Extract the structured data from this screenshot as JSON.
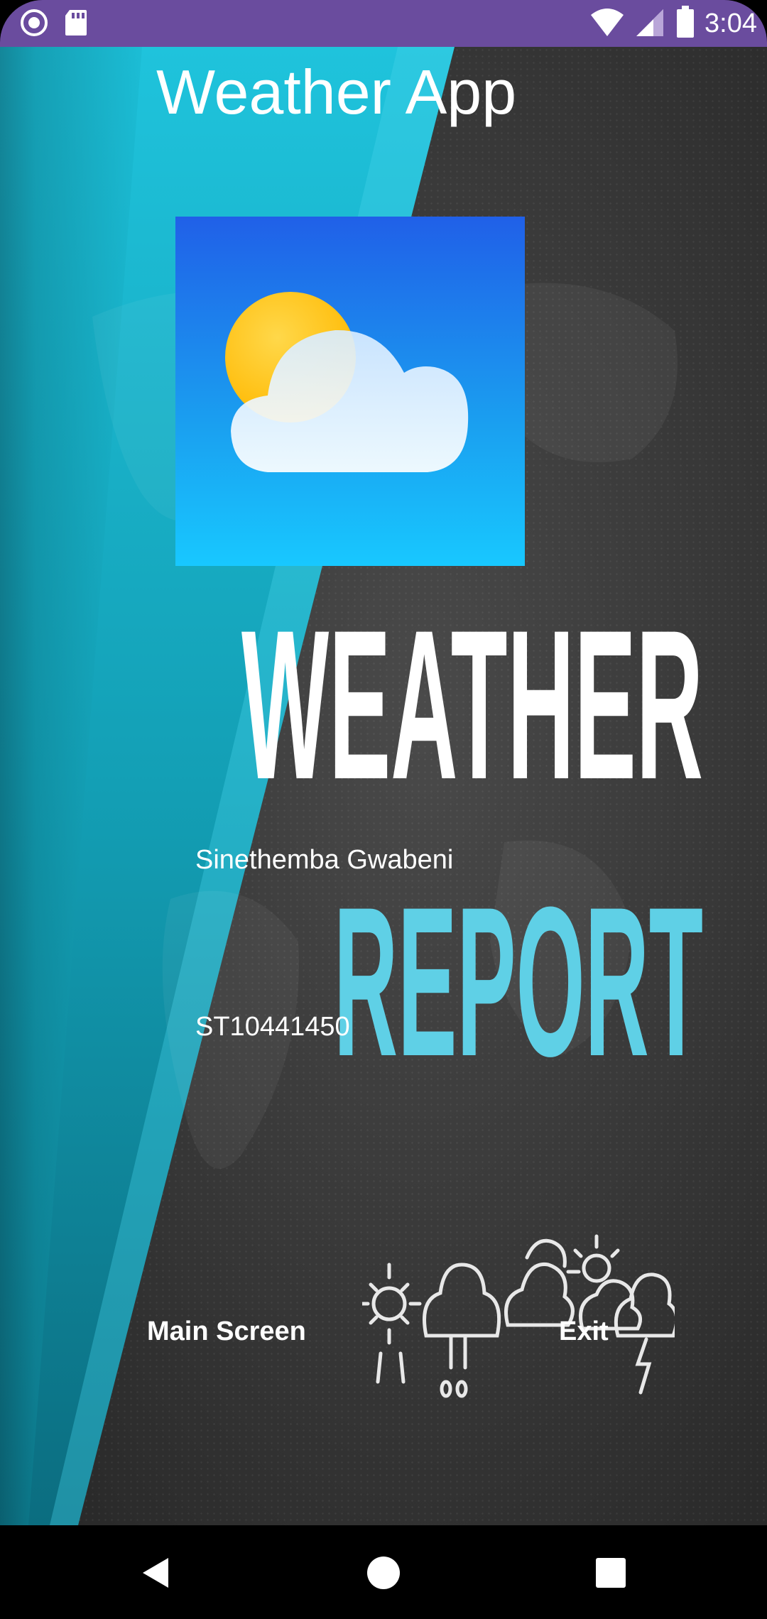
{
  "status_bar": {
    "time": "3:04",
    "icons": [
      "notification-circle-icon",
      "sd-card-icon",
      "wifi-icon",
      "signal-icon",
      "battery-icon"
    ]
  },
  "app": {
    "title": "Weather App",
    "logo_icon": "sun-cloud-icon",
    "background_wordmark": {
      "line1": "WEATHER",
      "line2": "REPORT"
    },
    "student_name": "Sinethemba Gwabeni",
    "student_id": "ST10441450",
    "buttons": {
      "main_screen": "Main Screen",
      "exit": "Exit"
    },
    "decor_icons": [
      "sun-icon",
      "rain-cloud-icon",
      "double-cloud-icon",
      "sun-behind-cloud-icon",
      "storm-cloud-icon"
    ]
  },
  "colors": {
    "status_bar": "#6a4c9e",
    "teal": "#19b8d0",
    "report_text": "#5fd0e6",
    "dark_bg": "#3a3a3a"
  },
  "nav_bar": {
    "icons": [
      "back-icon",
      "home-icon",
      "recents-icon"
    ]
  }
}
